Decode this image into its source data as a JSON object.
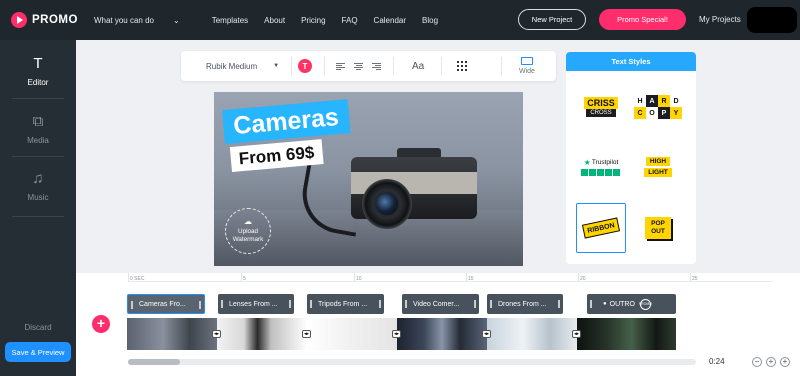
{
  "nav": {
    "logo": "PROMO",
    "links": [
      "What you can do",
      "Templates",
      "About",
      "Pricing",
      "FAQ",
      "Calendar",
      "Blog"
    ],
    "new_project": "New Project",
    "special": "Promo Special!",
    "my_projects": "My Projects"
  },
  "sidebar": {
    "items": [
      {
        "label": "Editor",
        "icon": "text-t-icon"
      },
      {
        "label": "Media",
        "icon": "media-icon"
      },
      {
        "label": "Music",
        "icon": "music-icon"
      }
    ],
    "discard": "Discard",
    "save": "Save & Preview"
  },
  "toolbar": {
    "font": "Rubik Medium",
    "color_btn": "T",
    "case_btn": "Aa",
    "layout_label": "Wide"
  },
  "canvas": {
    "headline": "Cameras",
    "subline": "From 69$",
    "watermark_line1": "Upload",
    "watermark_line2": "Watermark"
  },
  "styles": {
    "title": "Text Styles",
    "crisscross": {
      "a": "CRISS",
      "b": "CROSS"
    },
    "hardcopy": [
      "H",
      "A",
      "R",
      "D",
      "C",
      "O",
      "P",
      "Y"
    ],
    "trustpilot": "Trustpilot",
    "highlight": [
      "HIGH",
      "LIGHT"
    ],
    "ribbon": "RIBBON",
    "popout": [
      "POP",
      "OUT"
    ]
  },
  "timeline": {
    "ruler": [
      "0 SEC",
      "5",
      "10",
      "15",
      "20",
      "25"
    ],
    "clips": [
      "Cameras Fro...",
      "Lenses From ...",
      "Tripods From ...",
      "Video Comer...",
      "Drones From ...",
      "OUTRO"
    ],
    "outro_badge": "PROMO",
    "duration": "0:24",
    "zoom_in": "+",
    "zoom_out": "−",
    "add": "+"
  },
  "colors": {
    "accent_pink": "#ff2d6b",
    "accent_blue": "#1e90ff",
    "nav_bg": "#1f262c",
    "sidebar_bg": "#262e35",
    "style_yellow": "#ffd400"
  }
}
